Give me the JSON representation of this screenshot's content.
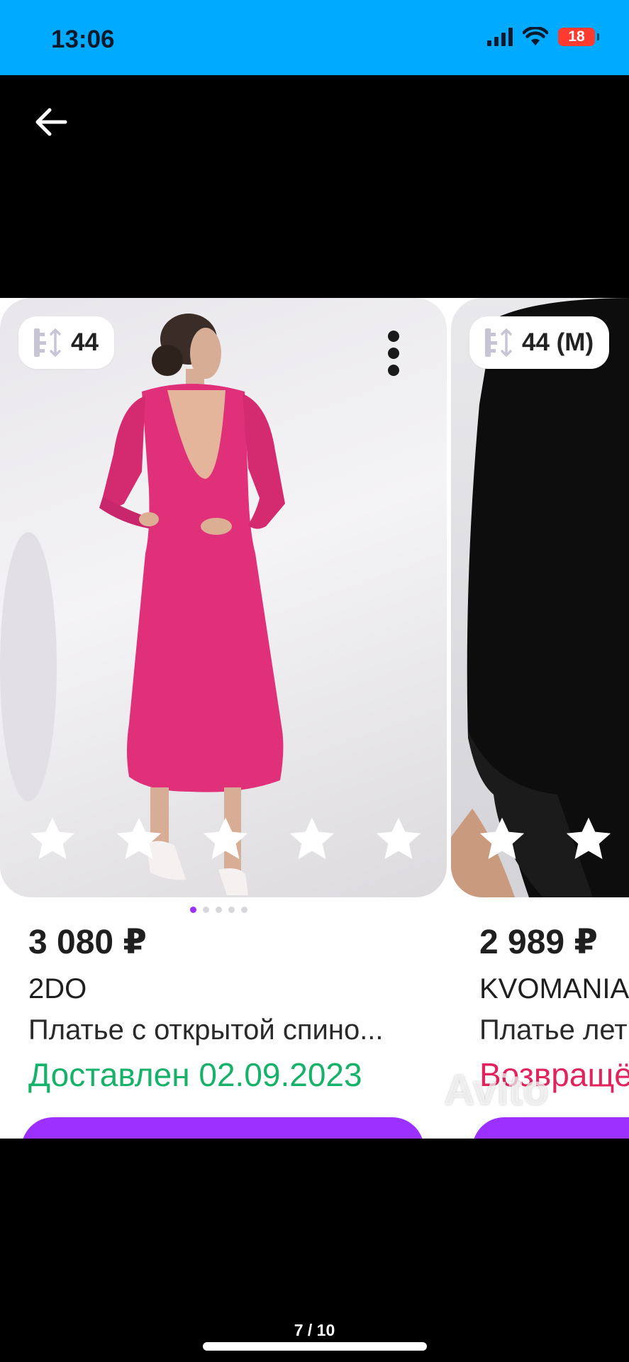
{
  "status_bar": {
    "time": "13:06",
    "battery": "18",
    "icons": [
      "signal-icon",
      "wifi-icon",
      "battery-icon"
    ],
    "colors": {
      "background": "#00aaff",
      "battery": "#ff3b30"
    }
  },
  "header": {
    "back_icon": "arrow-left-icon"
  },
  "cards": [
    {
      "size": "44",
      "price": "3 080 ₽",
      "brand": "2DO",
      "title": "Платье с открытой спино...",
      "status": "Доставлен 02.09.2023",
      "status_color": "#17b26a",
      "rating_stars": 5,
      "image": "pink-dress-photo"
    },
    {
      "size": "44 (M)",
      "price": "2 989 ₽",
      "brand": "KVOMANIA",
      "title": "Платье лет",
      "status": "Возвращё",
      "status_color": "#e0245e",
      "image": "black-garment-photo"
    }
  ],
  "pagination": {
    "current": 1,
    "total": 5
  },
  "watermark": "Avito",
  "viewer": {
    "counter": "7 / 10"
  },
  "accent_color": "#9b30ff"
}
